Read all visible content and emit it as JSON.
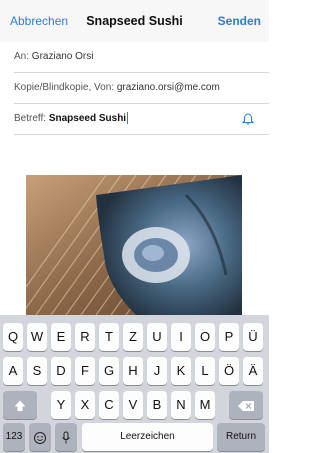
{
  "nav": {
    "cancel_label": "Abbrechen",
    "title": "Snapseed Sushi",
    "send_label": "Senden"
  },
  "fields": {
    "to_label": "An:",
    "to_value": "Graziano Orsi",
    "cc_label": "Kopie/Blindkopie, Von:",
    "cc_value": "graziano.orsi@me.com",
    "subject_label": "Betreff:",
    "subject_value": "Snapseed Sushi"
  },
  "keyboard": {
    "row1": [
      "Q",
      "W",
      "E",
      "R",
      "T",
      "Z",
      "U",
      "I",
      "O",
      "P",
      "Ü"
    ],
    "row2": [
      "A",
      "S",
      "D",
      "F",
      "G",
      "H",
      "J",
      "K",
      "L",
      "Ö",
      "Ä"
    ],
    "row3": [
      "Y",
      "X",
      "C",
      "V",
      "B",
      "N",
      "M"
    ],
    "numbers_label": "123",
    "space_label": "Leerzeichen",
    "return_label": "Return",
    "icons": {
      "shift": "shift-icon",
      "delete": "delete-icon",
      "emoji": "emoji-icon",
      "mic": "microphone-icon"
    }
  },
  "colors": {
    "accent": "#2e7bd8",
    "keyboard_bg": "#d2d5db"
  }
}
